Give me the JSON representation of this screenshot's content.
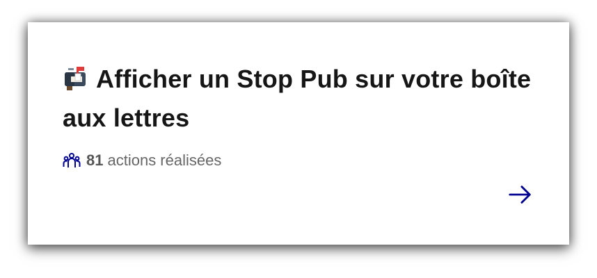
{
  "card": {
    "emoji_icon": "mailbox-with-flag-icon",
    "title": "Afficher un Stop Pub sur votre boîte aux lettres",
    "count": "81",
    "count_label": "actions réalisées",
    "people_icon": "people-group-icon",
    "arrow_icon": "arrow-right-icon"
  },
  "colors": {
    "title": "#161616",
    "meta_text": "#666666",
    "accent": "#000091"
  }
}
